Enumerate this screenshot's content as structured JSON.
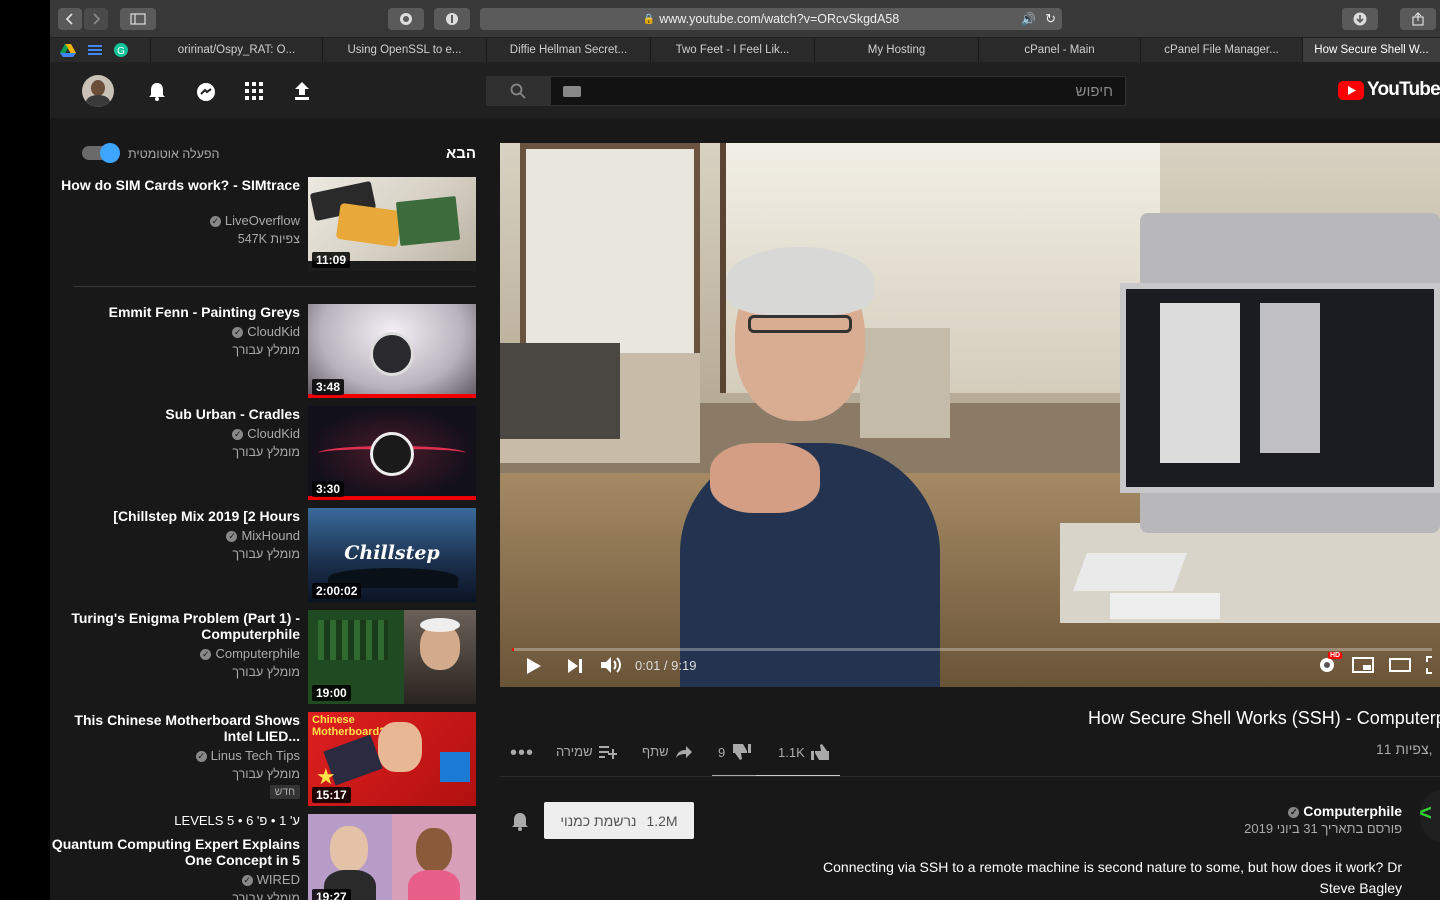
{
  "browser": {
    "url": "www.youtube.com/watch?v=ORcvSkgdA58",
    "tabs": [
      {
        "label": "oririnat/Ospy_RAT: O..."
      },
      {
        "label": "Using OpenSSL to e..."
      },
      {
        "label": "Diffie Hellman Secret..."
      },
      {
        "label": "Two Feet - I Feel Lik..."
      },
      {
        "label": "My Hosting"
      },
      {
        "label": "cPanel - Main"
      },
      {
        "label": "cPanel File Manager..."
      },
      {
        "label": "How Secure Shell W..."
      }
    ]
  },
  "header": {
    "search_placeholder": "חיפוש",
    "logo_text": "YouTube"
  },
  "upnext": {
    "title": "הבא",
    "autoplay_label": "הפעלה אוטומטית",
    "items": [
      {
        "title": "How do SIM Cards work? - SIMtrace",
        "channel": "LiveOverflow",
        "meta": "547K צפיות",
        "duration": "11:09"
      },
      {
        "title": "Emmit Fenn - Painting Greys",
        "channel": "CloudKid",
        "meta": "מומלץ עבורך",
        "duration": "3:48"
      },
      {
        "title": "Sub Urban - Cradles",
        "channel": "CloudKid",
        "meta": "מומלץ עבורך",
        "duration": "3:30"
      },
      {
        "title": "[Chillstep Mix 2019 [2 Hours",
        "channel": "MixHound",
        "meta": "מומלץ עבורך",
        "duration": "2:00:02",
        "thumb_text": "Chillstep"
      },
      {
        "title": "Turing's Enigma Problem (Part 1) - Computerphile",
        "channel": "Computerphile",
        "meta": "מומלץ עבורך",
        "duration": "19:00"
      },
      {
        "title": "This Chinese Motherboard Shows Intel LIED...",
        "channel": "Linus Tech Tips",
        "meta": "מומלץ עבורך",
        "badge": "חדש",
        "duration": "15:17",
        "thumb_text": "Chinese Motherboard??"
      },
      {
        "title": "Quantum Computing Expert Explains One Concept in 5",
        "channel": "WIRED",
        "meta": "מומלץ עבורך",
        "duration": "19:27",
        "top_meta": "LEVELS 5 • ע' 1 • פ' 6"
      }
    ]
  },
  "player": {
    "time": "0:01 / 9:19",
    "progress": 0.002
  },
  "video": {
    "title": "How Secure Shell Works (SSH) - Computerphile",
    "views": "11,",
    "views_suffix": "צפיות",
    "likes": "1.1K",
    "dislikes": "9",
    "share_label": "שתף",
    "save_label": "שמירה",
    "channel": "Computerphile",
    "published": "פורסם בתאריך 31 ביוני 2019",
    "subscribed_label": "נרשמת כמנוי",
    "subscribers": "1.2M",
    "description": "Connecting via SSH to a remote machine is second nature to some, but how does it work? Dr Steve Bagley"
  }
}
